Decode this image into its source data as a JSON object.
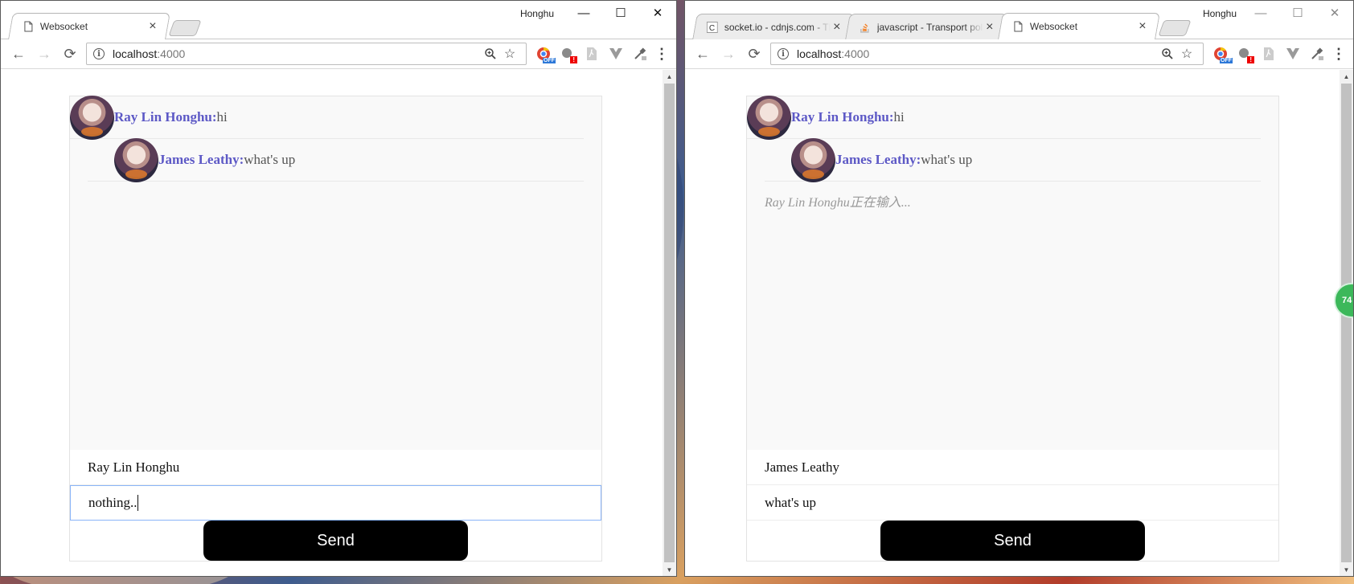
{
  "colors": {
    "accent_name": "#5d59c6",
    "send_button_bg": "#000000",
    "focus_border": "#8ab4f8",
    "badge_green": "#3cb85a"
  },
  "left_window": {
    "profile": "Honghu",
    "tabs": [
      {
        "title": "Websocket",
        "favicon": "page-icon",
        "active": true
      }
    ],
    "controls": {
      "minimize": "—",
      "maximize": "☐",
      "close": "✕"
    },
    "address": {
      "host": "localhost",
      "port": ":4000"
    },
    "chat": {
      "messages": [
        {
          "name": "Ray Lin Honghu:",
          "text": "hi"
        },
        {
          "name": "James Leathy:",
          "text": "what's up"
        }
      ],
      "typing": "",
      "name_value": "Ray Lin Honghu",
      "message_value": "nothing..",
      "send_label": "Send"
    }
  },
  "right_window": {
    "profile": "Honghu",
    "tabs": [
      {
        "title": "socket.io - cdnjs.com - The",
        "favicon": "c-icon",
        "active": false
      },
      {
        "title": "javascript - Transport polling",
        "favicon": "stackoverflow-icon",
        "active": false
      },
      {
        "title": "Websocket",
        "favicon": "page-icon",
        "active": true
      }
    ],
    "controls": {
      "minimize": "—",
      "maximize": "☐",
      "close": "✕"
    },
    "address": {
      "host": "localhost",
      "port": ":4000"
    },
    "chat": {
      "messages": [
        {
          "name": "Ray Lin Honghu:",
          "text": "hi"
        },
        {
          "name": "James Leathy:",
          "text": "what's up"
        }
      ],
      "typing": "Ray Lin Honghu正在输入...",
      "name_value": "James Leathy",
      "message_value": "what's up",
      "send_label": "Send"
    },
    "floating_badge": "74"
  },
  "toolbar": {
    "back": "←",
    "forward": "→",
    "reload": "⟳",
    "zoom": "🔍",
    "bookmark": "☆",
    "menu": "⋮",
    "ext_off_label": "OFF",
    "ext_alert_label": "!"
  }
}
